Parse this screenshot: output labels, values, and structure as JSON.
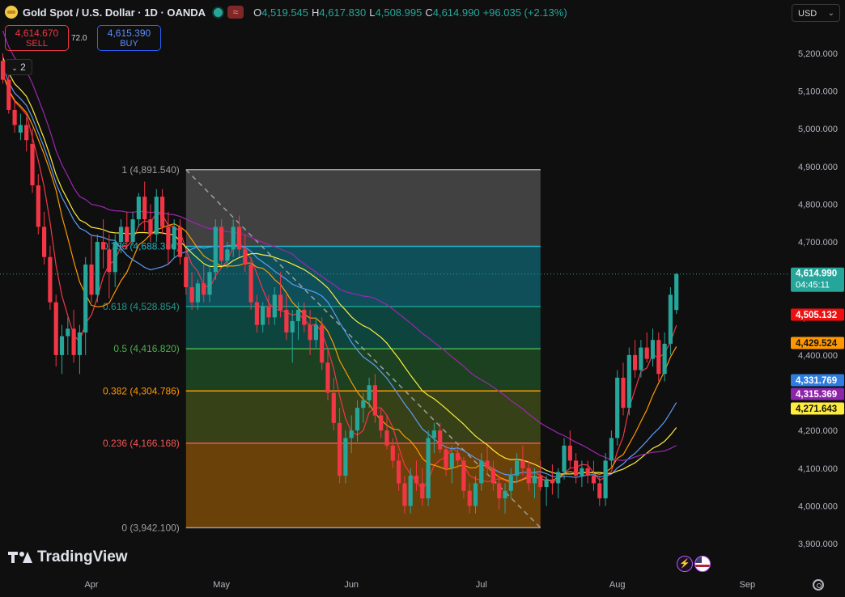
{
  "header": {
    "title": "Gold Spot / U.S. Dollar · 1D · OANDA",
    "wave_icon": "≈",
    "ohlc": [
      {
        "label": "O",
        "value": "4,519.545"
      },
      {
        "label": "H",
        "value": "4,617.830"
      },
      {
        "label": "L",
        "value": "4,508.995"
      },
      {
        "label": "C",
        "value": "4,614.990"
      }
    ],
    "change": "+96.035 (+2.13%)"
  },
  "trade": {
    "sell_price": "4,614.670",
    "sell_label": "SELL",
    "spread": "72.0",
    "buy_price": "4,615.390",
    "buy_label": "BUY"
  },
  "indicators_toggle": "2",
  "currency": "USD",
  "brand": "TradingView",
  "colors": {
    "up": "#26a69a",
    "down": "#f23645",
    "background": "#0f0f0f"
  },
  "chart_data": {
    "type": "candlestick",
    "ylim": [
      3880,
      5260
    ],
    "y_ticks": [
      {
        "value": 5200,
        "label": "5,200.000"
      },
      {
        "value": 5100,
        "label": "5,100.000"
      },
      {
        "value": 5000,
        "label": "5,000.000"
      },
      {
        "value": 4900,
        "label": "4,900.000"
      },
      {
        "value": 4800,
        "label": "4,800.000"
      },
      {
        "value": 4700,
        "label": "4,700.000"
      },
      {
        "value": 4600,
        "label": "4,600.000"
      },
      {
        "value": 4500,
        "label": "4,500.000"
      },
      {
        "value": 4400,
        "label": "4,400.000"
      },
      {
        "value": 4300,
        "label": "4,300.000"
      },
      {
        "value": 4200,
        "label": "4,200.000"
      },
      {
        "value": 4100,
        "label": "4,100.000"
      },
      {
        "value": 4000,
        "label": "4,000.000"
      },
      {
        "value": 3900,
        "label": "3,900.000"
      }
    ],
    "x_ticks": [
      {
        "label": "Apr",
        "index": 15
      },
      {
        "label": "May",
        "index": 37
      },
      {
        "label": "Jun",
        "index": 59
      },
      {
        "label": "Jul",
        "index": 81
      },
      {
        "label": "Aug",
        "index": 104
      },
      {
        "label": "Sep",
        "index": 126
      }
    ],
    "candles": [
      [
        5180,
        5200,
        5120,
        5130
      ],
      [
        5130,
        5150,
        5040,
        5050
      ],
      [
        5050,
        5080,
        4990,
        5010
      ],
      [
        4990,
        5040,
        4970,
        5010
      ],
      [
        5010,
        5030,
        4940,
        4970
      ],
      [
        4960,
        5000,
        4830,
        4850
      ],
      [
        4850,
        4880,
        4720,
        4740
      ],
      [
        4740,
        4780,
        4640,
        4660
      ],
      [
        4660,
        4690,
        4520,
        4540
      ],
      [
        4540,
        4560,
        4370,
        4400
      ],
      [
        4400,
        4480,
        4350,
        4450
      ],
      [
        4450,
        4500,
        4400,
        4470
      ],
      [
        4470,
        4520,
        4380,
        4400
      ],
      [
        4400,
        4480,
        4350,
        4460
      ],
      [
        4460,
        4660,
        4400,
        4640
      ],
      [
        4640,
        4720,
        4540,
        4560
      ],
      [
        4560,
        4720,
        4540,
        4700
      ],
      [
        4700,
        4760,
        4630,
        4680
      ],
      [
        4680,
        4720,
        4550,
        4620
      ],
      [
        4620,
        4720,
        4580,
        4700
      ],
      [
        4700,
        4760,
        4670,
        4740
      ],
      [
        4740,
        4780,
        4680,
        4700
      ],
      [
        4700,
        4780,
        4690,
        4760
      ],
      [
        4760,
        4830,
        4740,
        4820
      ],
      [
        4820,
        4860,
        4730,
        4760
      ],
      [
        4760,
        4800,
        4700,
        4720
      ],
      [
        4720,
        4840,
        4700,
        4820
      ],
      [
        4820,
        4840,
        4720,
        4740
      ],
      [
        4740,
        4780,
        4640,
        4680
      ],
      [
        4680,
        4760,
        4660,
        4740
      ],
      [
        4740,
        4760,
        4640,
        4660
      ],
      [
        4660,
        4680,
        4560,
        4580
      ],
      [
        4580,
        4620,
        4520,
        4540
      ],
      [
        4540,
        4600,
        4520,
        4590
      ],
      [
        4590,
        4640,
        4540,
        4560
      ],
      [
        4560,
        4640,
        4540,
        4620
      ],
      [
        4620,
        4760,
        4600,
        4740
      ],
      [
        4740,
        4760,
        4640,
        4650
      ],
      [
        4650,
        4700,
        4630,
        4680
      ],
      [
        4680,
        4760,
        4660,
        4740
      ],
      [
        4740,
        4770,
        4660,
        4680
      ],
      [
        4680,
        4720,
        4620,
        4640
      ],
      [
        4640,
        4660,
        4520,
        4540
      ],
      [
        4540,
        4560,
        4460,
        4480
      ],
      [
        4480,
        4540,
        4460,
        4530
      ],
      [
        4530,
        4560,
        4480,
        4500
      ],
      [
        4500,
        4580,
        4480,
        4560
      ],
      [
        4560,
        4620,
        4500,
        4520
      ],
      [
        4520,
        4560,
        4440,
        4460
      ],
      [
        4460,
        4520,
        4380,
        4490
      ],
      [
        4490,
        4540,
        4440,
        4520
      ],
      [
        4520,
        4540,
        4460,
        4480
      ],
      [
        4480,
        4520,
        4400,
        4440
      ],
      [
        4440,
        4500,
        4420,
        4480
      ],
      [
        4480,
        4500,
        4360,
        4380
      ],
      [
        4380,
        4420,
        4280,
        4300
      ],
      [
        4300,
        4340,
        4200,
        4220
      ],
      [
        4220,
        4260,
        4060,
        4080
      ],
      [
        4080,
        4200,
        4060,
        4180
      ],
      [
        4180,
        4240,
        4140,
        4200
      ],
      [
        4200,
        4280,
        4170,
        4260
      ],
      [
        4260,
        4300,
        4220,
        4280
      ],
      [
        4280,
        4340,
        4260,
        4320
      ],
      [
        4320,
        4350,
        4220,
        4240
      ],
      [
        4240,
        4260,
        4180,
        4200
      ],
      [
        4200,
        4240,
        4150,
        4160
      ],
      [
        4160,
        4180,
        4100,
        4120
      ],
      [
        4120,
        4140,
        4040,
        4060
      ],
      [
        4060,
        4080,
        3980,
        4000
      ],
      [
        4000,
        4100,
        3980,
        4080
      ],
      [
        4080,
        4120,
        4040,
        4060
      ],
      [
        4060,
        4100,
        4000,
        4020
      ],
      [
        4020,
        4200,
        4000,
        4180
      ],
      [
        4180,
        4220,
        4140,
        4200
      ],
      [
        4200,
        4220,
        4140,
        4150
      ],
      [
        4150,
        4160,
        4080,
        4100
      ],
      [
        4100,
        4160,
        4060,
        4140
      ],
      [
        4140,
        4160,
        4100,
        4120
      ],
      [
        4120,
        4130,
        4020,
        4040
      ],
      [
        4040,
        4060,
        3980,
        4000
      ],
      [
        4000,
        4080,
        3980,
        4060
      ],
      [
        4060,
        4140,
        4040,
        4120
      ],
      [
        4120,
        4160,
        4080,
        4100
      ],
      [
        4100,
        4120,
        4040,
        4060
      ],
      [
        4060,
        4080,
        3990,
        4020
      ],
      [
        4020,
        4060,
        3980,
        4040
      ],
      [
        4040,
        4100,
        4020,
        4080
      ],
      [
        4080,
        4140,
        4060,
        4120
      ],
      [
        4120,
        4160,
        4080,
        4100
      ],
      [
        4100,
        4120,
        4040,
        4060
      ],
      [
        4060,
        4100,
        4020,
        4080
      ],
      [
        4080,
        4120,
        4040,
        4050
      ],
      [
        4050,
        4080,
        4000,
        4070
      ],
      [
        4070,
        4110,
        4030,
        4060
      ],
      [
        4060,
        4100,
        4020,
        4090
      ],
      [
        4090,
        4180,
        4070,
        4160
      ],
      [
        4160,
        4200,
        4100,
        4120
      ],
      [
        4120,
        4140,
        4060,
        4080
      ],
      [
        4080,
        4120,
        4050,
        4100
      ],
      [
        4100,
        4120,
        4060,
        4080
      ],
      [
        4080,
        4120,
        4040,
        4060
      ],
      [
        4060,
        4080,
        4000,
        4020
      ],
      [
        4020,
        4140,
        4000,
        4120
      ],
      [
        4120,
        4200,
        4100,
        4180
      ],
      [
        4180,
        4360,
        4160,
        4340
      ],
      [
        4340,
        4380,
        4240,
        4260
      ],
      [
        4260,
        4420,
        4240,
        4400
      ],
      [
        4400,
        4440,
        4340,
        4360
      ],
      [
        4360,
        4440,
        4340,
        4420
      ],
      [
        4420,
        4460,
        4380,
        4390
      ],
      [
        4390,
        4470,
        4370,
        4440
      ],
      [
        4440,
        4460,
        4330,
        4350
      ],
      [
        4350,
        4460,
        4330,
        4430
      ],
      [
        4430,
        4580,
        4400,
        4560
      ],
      [
        4519.545,
        4617.83,
        4508.995,
        4614.99
      ]
    ],
    "moving_averages": [
      {
        "color": "#f23645",
        "last_label": "4,505.132",
        "period": 5
      },
      {
        "color": "#ff9800",
        "last_label": "4,429.524",
        "period": 10
      },
      {
        "color": "#5b9cf5",
        "last_label": "4,331.769",
        "period": 20
      },
      {
        "color": "#ffeb3b",
        "last_label": "4,271.643",
        "period": 30
      },
      {
        "color": "#9c27b0",
        "last_label": "4,315.369",
        "period": 50
      }
    ],
    "last_price_label": "4,614.990",
    "countdown": "04:45:11",
    "fibonacci": {
      "start_index": 31,
      "end_index": 91,
      "high": 4891.54,
      "low": 3942.1,
      "levels": [
        {
          "ratio": "1",
          "value": 4891.54,
          "label": "1 (4,891.540)",
          "color": "#9e9e9e",
          "fill": "#4a4a4a"
        },
        {
          "ratio": "0.786",
          "value": 4688.36,
          "label": "0.786 (4,688.360)",
          "color": "#22b5c9",
          "fill": "#0f5a66"
        },
        {
          "ratio": "0.618",
          "value": 4528.854,
          "label": "0.618 (4,528.854)",
          "color": "#1e9b8f",
          "fill": "#0e4e46"
        },
        {
          "ratio": "0.5",
          "value": 4416.82,
          "label": "0.5 (4,416.820)",
          "color": "#4caf50",
          "fill": "#1f4a24"
        },
        {
          "ratio": "0.382",
          "value": 4304.786,
          "label": "0.382 (4,304.786)",
          "color": "#ff9800",
          "fill": "#3e4a1a"
        },
        {
          "ratio": "0.236",
          "value": 4166.168,
          "label": "0.236 (4,166.168)",
          "color": "#f05656",
          "fill": "#7a4a08"
        },
        {
          "ratio": "0",
          "value": 3942.1,
          "label": "0 (3,942.100)",
          "color": "#9e9e9e",
          "fill": "#7a2429"
        }
      ]
    }
  }
}
